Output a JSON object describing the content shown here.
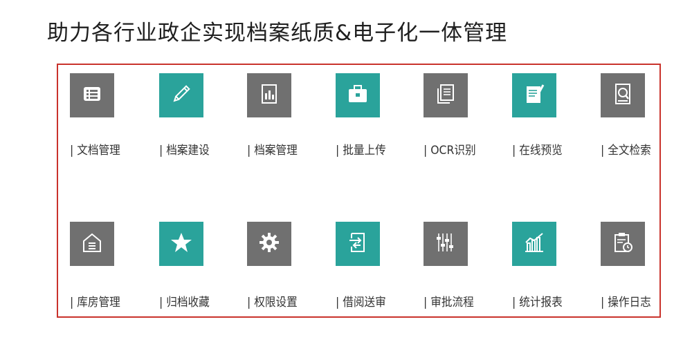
{
  "headline": "助力各行业政企实现档案纸质&电子化一体管理",
  "colors": {
    "teal": "#2aa39b",
    "gray": "#707070",
    "border": "#c9322b"
  },
  "features": [
    {
      "label": "| 文档管理",
      "icon": "list-icon",
      "color": "gray"
    },
    {
      "label": "| 档案建设",
      "icon": "pencil-icon",
      "color": "teal"
    },
    {
      "label": "| 档案管理",
      "icon": "document-chart-icon",
      "color": "gray"
    },
    {
      "label": "| 批量上传",
      "icon": "briefcase-icon",
      "color": "teal"
    },
    {
      "label": "| OCR识别",
      "icon": "copy-document-icon",
      "color": "gray"
    },
    {
      "label": "| 在线预览",
      "icon": "notepad-pen-icon",
      "color": "teal"
    },
    {
      "label": "| 全文检索",
      "icon": "document-search-icon",
      "color": "gray"
    },
    {
      "label": "| 库房管理",
      "icon": "warehouse-icon",
      "color": "gray"
    },
    {
      "label": "| 归档收藏",
      "icon": "star-icon",
      "color": "teal"
    },
    {
      "label": "| 权限设置",
      "icon": "gear-icon",
      "color": "gray"
    },
    {
      "label": "| 借阅送审",
      "icon": "transfer-document-icon",
      "color": "teal"
    },
    {
      "label": "| 审批流程",
      "icon": "sliders-icon",
      "color": "gray"
    },
    {
      "label": "| 统计报表",
      "icon": "bar-chart-icon",
      "color": "teal"
    },
    {
      "label": "| 操作日志",
      "icon": "clipboard-clock-icon",
      "color": "gray"
    }
  ]
}
